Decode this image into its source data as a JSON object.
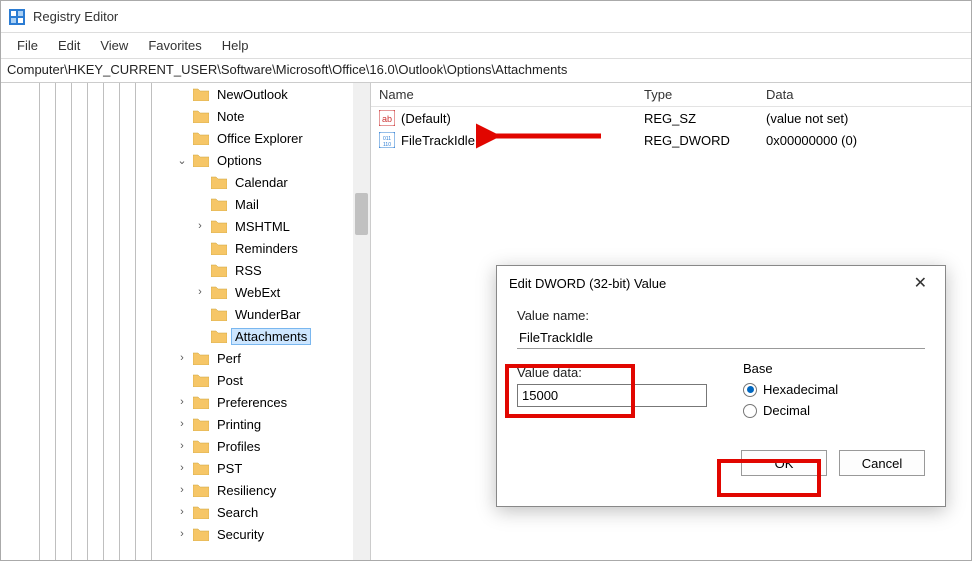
{
  "window": {
    "title": "Registry Editor"
  },
  "menu": {
    "file": "File",
    "edit": "Edit",
    "view": "View",
    "favorites": "Favorites",
    "help": "Help"
  },
  "address": "Computer\\HKEY_CURRENT_USER\\Software\\Microsoft\\Office\\16.0\\Outlook\\Options\\Attachments",
  "tree": [
    {
      "indent": 0,
      "expander": "",
      "label": "NewOutlook"
    },
    {
      "indent": 0,
      "expander": "",
      "label": "Note"
    },
    {
      "indent": 0,
      "expander": "",
      "label": "Office Explorer"
    },
    {
      "indent": 0,
      "expander": "v",
      "label": "Options"
    },
    {
      "indent": 1,
      "expander": "",
      "label": "Calendar"
    },
    {
      "indent": 1,
      "expander": "",
      "label": "Mail"
    },
    {
      "indent": 1,
      "expander": ">",
      "label": "MSHTML"
    },
    {
      "indent": 1,
      "expander": "",
      "label": "Reminders"
    },
    {
      "indent": 1,
      "expander": "",
      "label": "RSS"
    },
    {
      "indent": 1,
      "expander": ">",
      "label": "WebExt"
    },
    {
      "indent": 1,
      "expander": "",
      "label": "WunderBar"
    },
    {
      "indent": 1,
      "expander": "",
      "label": "Attachments",
      "selected": true
    },
    {
      "indent": 0,
      "expander": ">",
      "label": "Perf"
    },
    {
      "indent": 0,
      "expander": "",
      "label": "Post"
    },
    {
      "indent": 0,
      "expander": ">",
      "label": "Preferences"
    },
    {
      "indent": 0,
      "expander": ">",
      "label": "Printing"
    },
    {
      "indent": 0,
      "expander": ">",
      "label": "Profiles"
    },
    {
      "indent": 0,
      "expander": ">",
      "label": "PST"
    },
    {
      "indent": 0,
      "expander": ">",
      "label": "Resiliency"
    },
    {
      "indent": 0,
      "expander": ">",
      "label": "Search"
    },
    {
      "indent": 0,
      "expander": ">",
      "label": "Security"
    }
  ],
  "list": {
    "headers": {
      "name": "Name",
      "type": "Type",
      "data": "Data"
    },
    "rows": [
      {
        "icon": "ab",
        "name": "(Default)",
        "type": "REG_SZ",
        "data": "(value not set)"
      },
      {
        "icon": "bin",
        "name": "FileTrackIdle",
        "type": "REG_DWORD",
        "data": "0x00000000 (0)"
      }
    ]
  },
  "dialog": {
    "title": "Edit DWORD (32-bit) Value",
    "close": "✕",
    "value_name_label": "Value name:",
    "value_name": "FileTrackIdle",
    "value_data_label": "Value data:",
    "value_data": "15000",
    "base_label": "Base",
    "hex_label": "Hexadecimal",
    "dec_label": "Decimal",
    "ok": "OK",
    "cancel": "Cancel"
  }
}
